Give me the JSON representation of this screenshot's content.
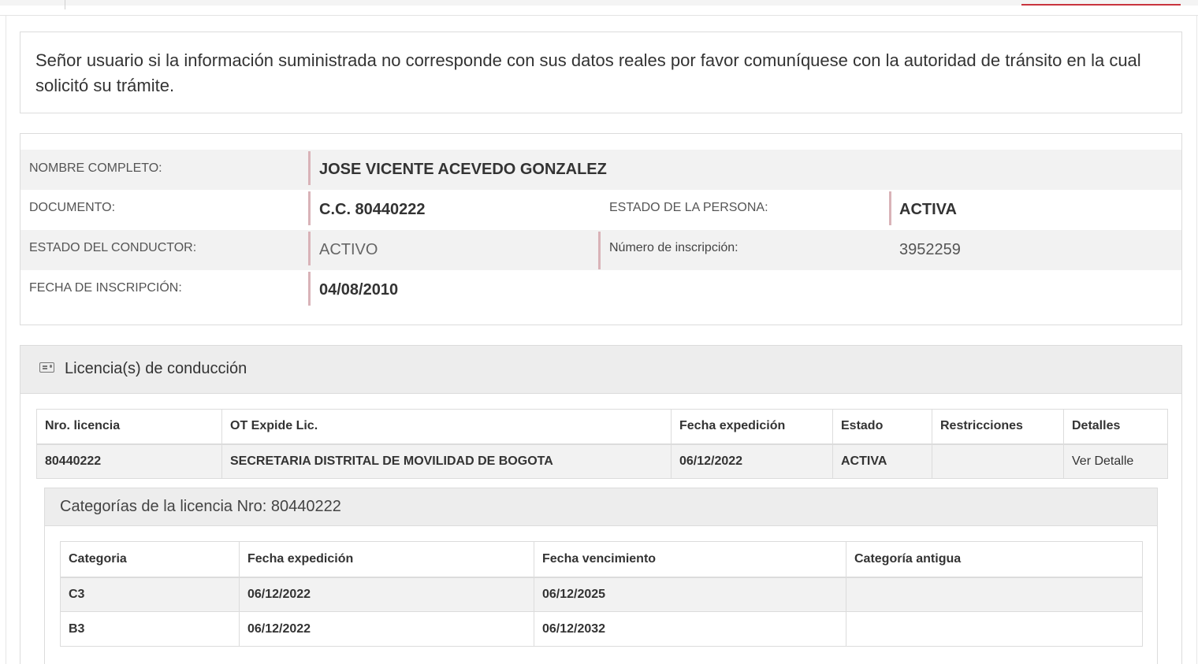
{
  "notice": {
    "text": "Señor usuario si la información suministrada no corresponde con sus datos reales por favor comuníquese con la autoridad de tránsito en la cual solicitó su trámite."
  },
  "person": {
    "nombre_label": "NOMBRE COMPLETO:",
    "nombre_value": "JOSE VICENTE ACEVEDO GONZALEZ",
    "documento_label": "DOCUMENTO:",
    "documento_value": "C.C. 80440222",
    "estado_persona_label": "ESTADO DE LA PERSONA:",
    "estado_persona_value": "ACTIVA",
    "estado_conductor_label": "ESTADO DEL CONDUCTOR:",
    "estado_conductor_value": "ACTIVO",
    "numero_inscripcion_label": "Número de inscripción:",
    "numero_inscripcion_value": "3952259",
    "fecha_inscripcion_label": "FECHA DE INSCRIPCIÓN:",
    "fecha_inscripcion_value": "04/08/2010"
  },
  "licencias": {
    "title": "Licencia(s) de conducción",
    "icon": "id-card-icon",
    "columns": [
      "Nro. licencia",
      "OT Expide Lic.",
      "Fecha expedición",
      "Estado",
      "Restricciones",
      "Detalles"
    ],
    "rows": [
      {
        "nro": "80440222",
        "ot": "SECRETARIA DISTRITAL DE MOVILIDAD DE BOGOTA",
        "fecha": "06/12/2022",
        "estado": "ACTIVA",
        "restricciones": "",
        "detalles": "Ver Detalle"
      }
    ]
  },
  "categorias": {
    "title": "Categorías de la licencia Nro: 80440222",
    "columns": [
      "Categoria",
      "Fecha expedición",
      "Fecha vencimiento",
      "Categoría antigua"
    ],
    "rows": [
      {
        "categoria": "C3",
        "expedicion": "06/12/2022",
        "vencimiento": "06/12/2025",
        "antigua": ""
      },
      {
        "categoria": "B3",
        "expedicion": "06/12/2022",
        "vencimiento": "06/12/2032",
        "antigua": ""
      }
    ]
  },
  "colors": {
    "accent_red": "#c9343e",
    "divider_pink": "#d9b3b8",
    "row_shade": "#f2f2f2",
    "header_shade": "#ededed"
  }
}
